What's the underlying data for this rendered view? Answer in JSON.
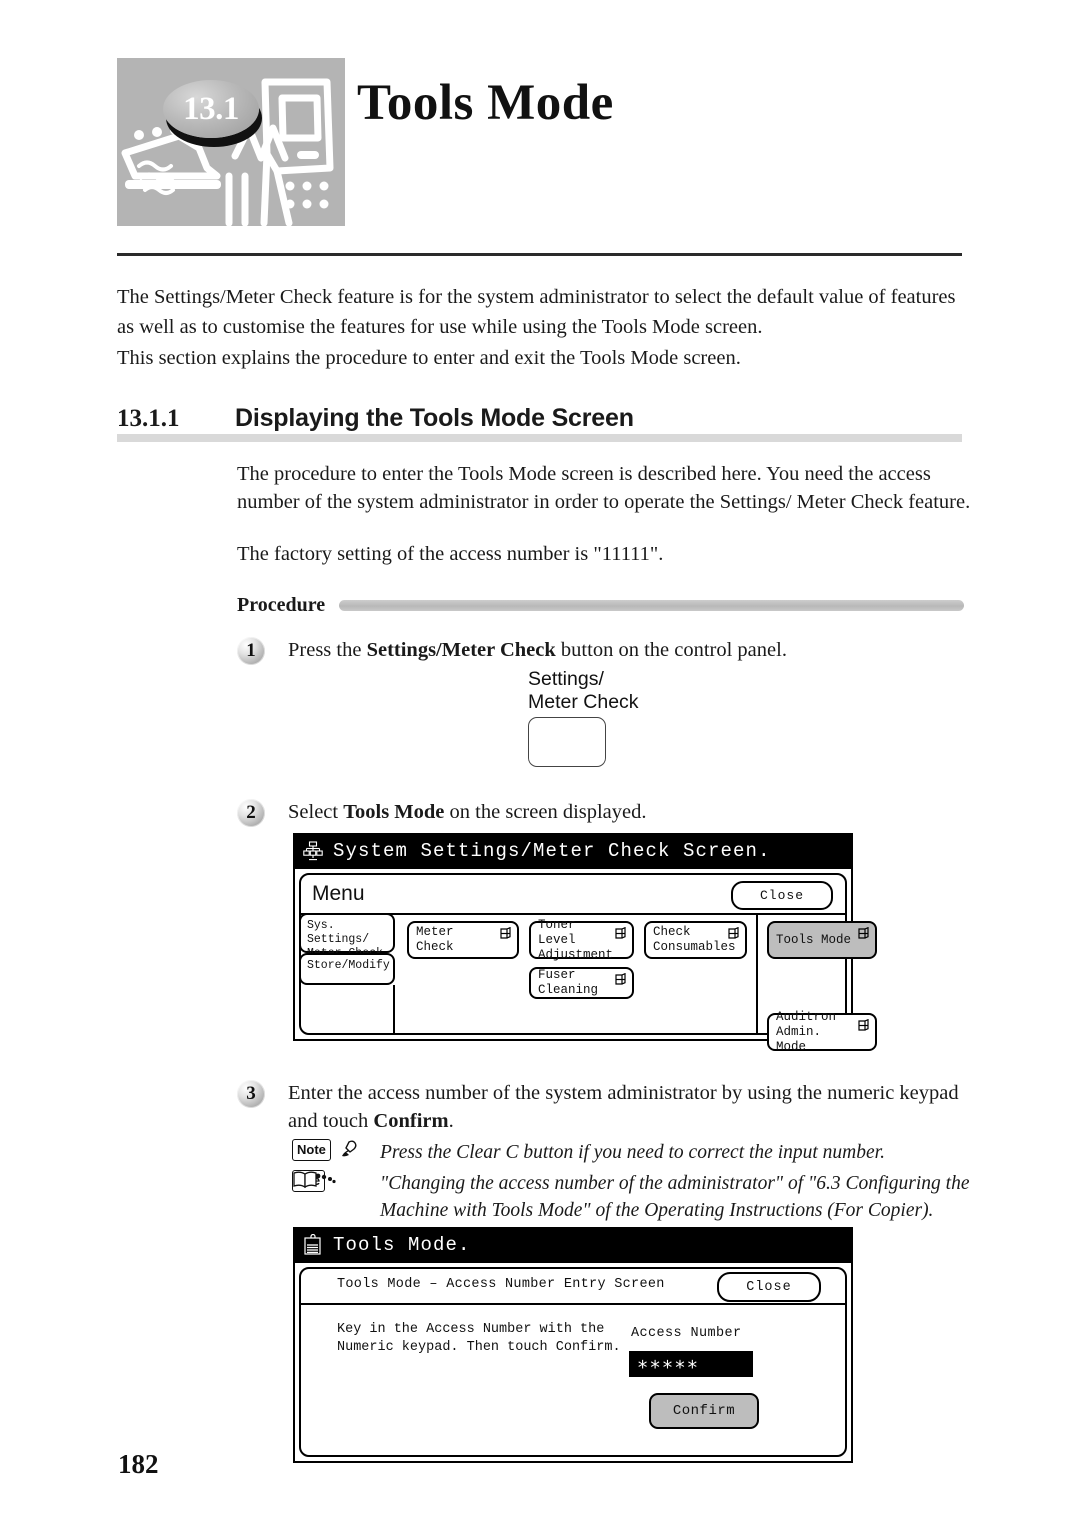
{
  "chapter": {
    "number": "13.1",
    "title": "Tools Mode",
    "art_icon": "copier-illustration"
  },
  "intro": {
    "paragraph_1": "The Settings/Meter Check feature is for the system administrator to select the default value of features as well as to customise the features for use while using the Tools Mode screen.",
    "paragraph_2": "This section explains the procedure to enter and exit the Tools Mode screen."
  },
  "section": {
    "number": "13.1.1",
    "title": "Displaying the Tools Mode Screen",
    "body_1": "The procedure to enter the Tools Mode screen is described here. You need the access number of the system administrator in order to operate the Settings/ Meter Check feature.",
    "body_2": "The factory setting of the access number is \"11111\"."
  },
  "procedure": {
    "label": "Procedure",
    "steps": [
      {
        "marker": "1",
        "text_before": "Press the ",
        "text_bold": "Settings/Meter Check",
        "text_after": " button on the control panel."
      },
      {
        "marker": "2",
        "text_before": "Select ",
        "text_bold": "Tools Mode",
        "text_after": " on the screen displayed."
      },
      {
        "marker": "3",
        "text_before": "Enter the access number of the system administrator by using the numeric keypad and touch ",
        "text_bold": "Confirm",
        "text_after": "."
      }
    ]
  },
  "control_panel_button": {
    "label": "Settings/\nMeter Check",
    "key_name": "settings-meter-check-key"
  },
  "annotations": [
    {
      "chip": "Note",
      "icon": "pencil-note-icon",
      "text": "Press the Clear C button if you need to correct the input number."
    },
    {
      "chip": "See",
      "icon": "open-book-icon",
      "text": "\"Changing the access number of the administrator\" of \"6.3 Configuring the Machine with Tools Mode\" of the Operating Instructions (For Copier)."
    }
  ],
  "screen_menu": {
    "title": "System Settings/Meter Check Screen.",
    "title_icon": "network-hierarchy-icon",
    "header_label": "Menu",
    "close_label": "Close",
    "tabs": [
      {
        "label": "Sys. Settings/\nMeter Check"
      },
      {
        "label": "Store/Modify"
      }
    ],
    "buttons": [
      {
        "label": "Meter Check",
        "selected": false,
        "flag": true
      },
      {
        "label": "Toner Level\nAdjustment",
        "selected": false,
        "flag": true
      },
      {
        "label": "Check\nConsumables",
        "selected": false,
        "flag": true
      },
      {
        "label": "Tools Mode",
        "selected": true,
        "flag": true
      },
      {
        "label": "Fuser Cleaning",
        "selected": false,
        "flag": true
      },
      {
        "label": "Auditron\nAdmin. Mode",
        "selected": false,
        "flag": true
      }
    ]
  },
  "screen_tools": {
    "title": "Tools Mode.",
    "title_icon": "clipboard-document-icon",
    "header_label": "Tools Mode – Access Number Entry Screen",
    "close_label": "Close",
    "instruction": "Key in the Access Number with the\nNumeric keypad. Then touch Confirm.",
    "access_number_label": "Access Number",
    "access_number_value": "∗∗∗∗∗",
    "confirm_label": "Confirm"
  },
  "page_number": "182",
  "colors": {
    "selected_button": "#bdbdbd",
    "titlebar": "#000000",
    "section_rule": "#d9d9d9",
    "chapter_art": "#b4b4b4"
  }
}
